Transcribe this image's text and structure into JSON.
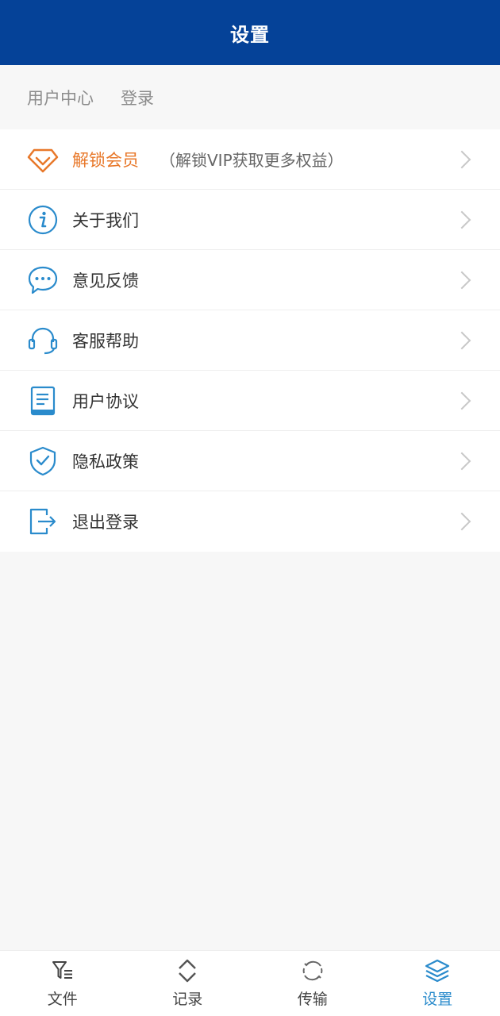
{
  "header": {
    "title": "设置"
  },
  "user": {
    "center_label": "用户中心",
    "login_label": "登录"
  },
  "menu": {
    "items": [
      {
        "label": "解锁会员",
        "sub": "（解锁VIP获取更多权益）",
        "icon": "diamond-icon"
      },
      {
        "label": "关于我们",
        "icon": "info-icon"
      },
      {
        "label": "意见反馈",
        "icon": "chat-bubble-icon"
      },
      {
        "label": "客服帮助",
        "icon": "headset-icon"
      },
      {
        "label": "用户协议",
        "icon": "document-icon"
      },
      {
        "label": "隐私政策",
        "icon": "shield-check-icon"
      },
      {
        "label": "退出登录",
        "icon": "logout-icon"
      }
    ]
  },
  "tabs": [
    {
      "label": "文件",
      "icon": "filter-icon"
    },
    {
      "label": "记录",
      "icon": "sort-arrows-icon"
    },
    {
      "label": "传输",
      "icon": "sync-icon"
    },
    {
      "label": "设置",
      "icon": "layers-icon",
      "active": true
    }
  ],
  "colors": {
    "header_bg": "#054298",
    "accent": "#2a8bcc",
    "vip": "#e8782a"
  }
}
